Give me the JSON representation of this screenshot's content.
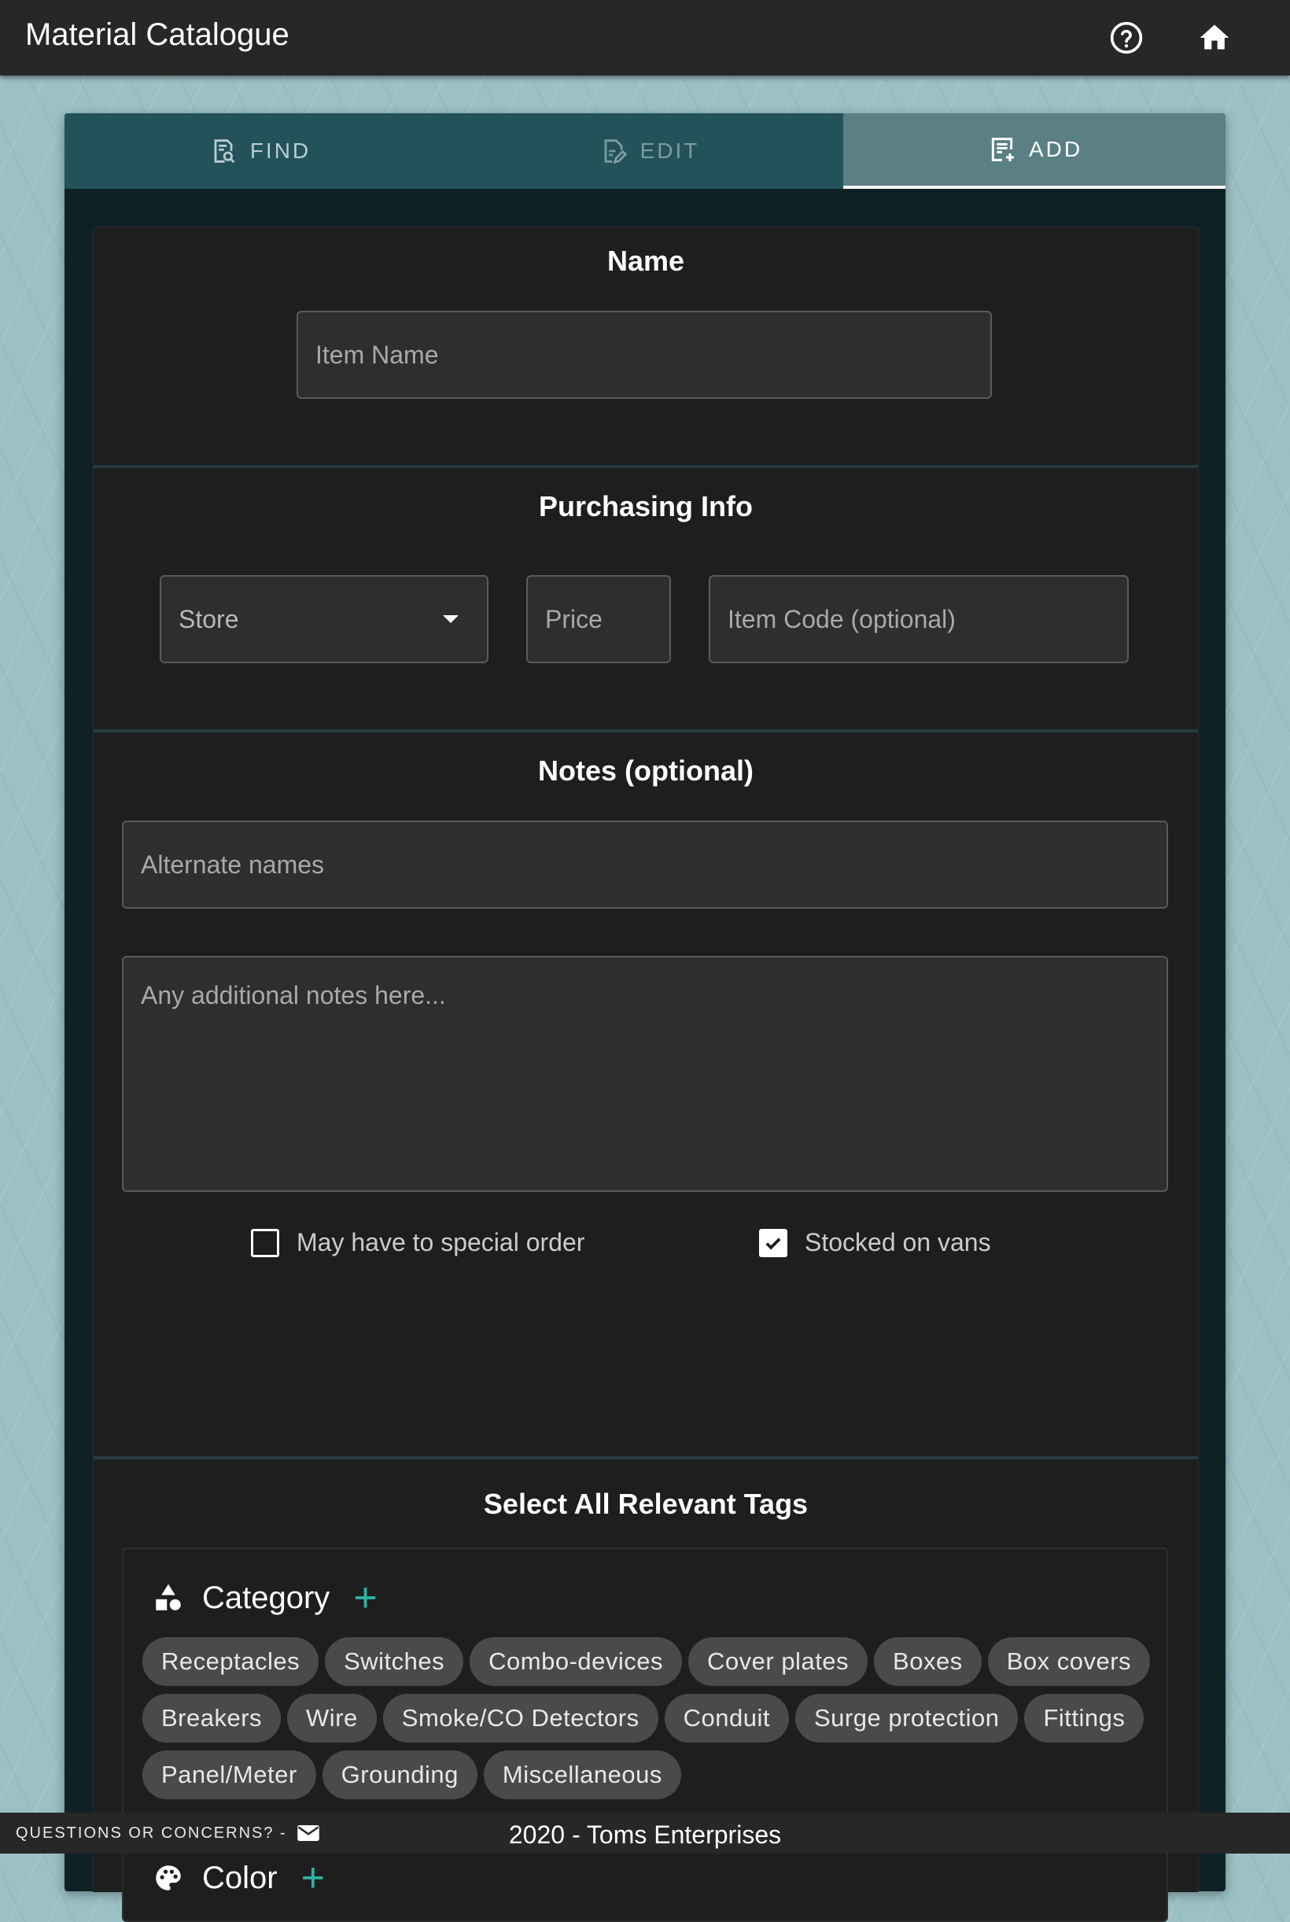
{
  "app": {
    "title": "Material Catalogue"
  },
  "tabs": [
    {
      "label": "FIND",
      "icon": "find-doc-icon",
      "active": false
    },
    {
      "label": "EDIT",
      "icon": "edit-doc-icon",
      "active": false
    },
    {
      "label": "ADD",
      "icon": "add-doc-icon",
      "active": true
    }
  ],
  "name_section": {
    "title": "Name",
    "item_name_placeholder": "Item Name"
  },
  "purchasing": {
    "title": "Purchasing Info",
    "store_label": "Store",
    "price_placeholder": "Price",
    "item_code_placeholder": "Item Code (optional)"
  },
  "notes": {
    "title": "Notes (optional)",
    "alternate_placeholder": "Alternate names",
    "additional_placeholder": "Any additional notes here...",
    "special_order": {
      "label": "May have to special order",
      "checked": false
    },
    "stocked_vans": {
      "label": "Stocked on vans",
      "checked": true
    }
  },
  "tags": {
    "title": "Select All Relevant Tags",
    "category": {
      "label": "Category",
      "icon": "shapes-icon",
      "chips": [
        "Receptacles",
        "Switches",
        "Combo-devices",
        "Cover plates",
        "Boxes",
        "Box covers",
        "Breakers",
        "Wire",
        "Smoke/CO Detectors",
        "Conduit",
        "Surge protection",
        "Fittings",
        "Panel/Meter",
        "Grounding",
        "Miscellaneous"
      ]
    },
    "color": {
      "label": "Color",
      "icon": "palette-icon"
    }
  },
  "footer": {
    "questions": "QUESTIONS OR CONCERNS? -",
    "copyright": "2020 - Toms Enterprises"
  },
  "colors": {
    "accent": "#2bb3a3",
    "appbar": "#272727",
    "tab_bar": "#23525a",
    "active_tab": "#5a8084",
    "panel": "#1e1e1e"
  }
}
